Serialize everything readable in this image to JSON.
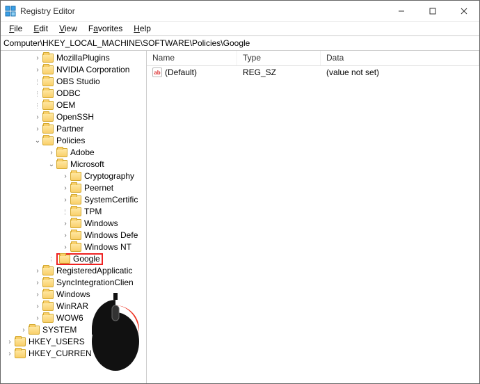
{
  "window": {
    "title": "Registry Editor"
  },
  "menu": {
    "file": "File",
    "edit": "Edit",
    "view": "View",
    "favorites": "Favorites",
    "help": "Help"
  },
  "address": {
    "path": "Computer\\HKEY_LOCAL_MACHINE\\SOFTWARE\\Policies\\Google"
  },
  "tree": {
    "items": [
      {
        "indent": 2,
        "twisty": ">",
        "label": "MozillaPlugins"
      },
      {
        "indent": 2,
        "twisty": ">",
        "label": "NVIDIA Corporation"
      },
      {
        "indent": 2,
        "twisty": "",
        "label": "OBS Studio",
        "vline": true
      },
      {
        "indent": 2,
        "twisty": "",
        "label": "ODBC",
        "vline": true
      },
      {
        "indent": 2,
        "twisty": "",
        "label": "OEM",
        "vline": true
      },
      {
        "indent": 2,
        "twisty": ">",
        "label": "OpenSSH"
      },
      {
        "indent": 2,
        "twisty": ">",
        "label": "Partner"
      },
      {
        "indent": 2,
        "twisty": "v",
        "label": "Policies"
      },
      {
        "indent": 3,
        "twisty": ">",
        "label": "Adobe"
      },
      {
        "indent": 3,
        "twisty": "v",
        "label": "Microsoft"
      },
      {
        "indent": 4,
        "twisty": ">",
        "label": "Cryptography"
      },
      {
        "indent": 4,
        "twisty": ">",
        "label": "Peernet"
      },
      {
        "indent": 4,
        "twisty": ">",
        "label": "SystemCertific"
      },
      {
        "indent": 4,
        "twisty": "",
        "label": "TPM",
        "vline": true
      },
      {
        "indent": 4,
        "twisty": ">",
        "label": "Windows"
      },
      {
        "indent": 4,
        "twisty": ">",
        "label": "Windows Defe"
      },
      {
        "indent": 4,
        "twisty": ">",
        "label": "Windows NT"
      },
      {
        "indent": 3,
        "twisty": "",
        "label": "Google",
        "highlight": true,
        "vline": true
      },
      {
        "indent": 2,
        "twisty": ">",
        "label": "RegisteredApplicatic"
      },
      {
        "indent": 2,
        "twisty": ">",
        "label": "SyncIntegrationClien"
      },
      {
        "indent": 2,
        "twisty": ">",
        "label": "Windows"
      },
      {
        "indent": 2,
        "twisty": ">",
        "label": "WinRAR"
      },
      {
        "indent": 2,
        "twisty": ">",
        "label": "WOW6"
      },
      {
        "indent": 1,
        "twisty": ">",
        "label": "SYSTEM"
      },
      {
        "indent": 0,
        "twisty": ">",
        "label": "HKEY_USERS"
      },
      {
        "indent": 0,
        "twisty": ">",
        "label": "HKEY_CURREN"
      }
    ]
  },
  "list": {
    "headers": {
      "name": "Name",
      "type": "Type",
      "data": "Data"
    },
    "rows": [
      {
        "icon": "ab",
        "name": "(Default)",
        "type": "REG_SZ",
        "data": "(value not set)"
      }
    ]
  }
}
